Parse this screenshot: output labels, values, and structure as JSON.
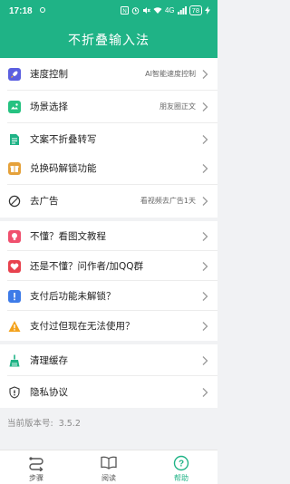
{
  "status_bar": {
    "time": "17:18",
    "network": "4G",
    "battery": "78"
  },
  "header": {
    "title": "不折叠输入法"
  },
  "colors": {
    "accent": "#1fb386",
    "background": "#f1f2f4"
  },
  "groups": [
    {
      "items": [
        {
          "label": "速度控制",
          "value": "AI智能速度控制",
          "icon": "rocket-icon"
        },
        {
          "label": "场景选择",
          "value": "朋友圈正文",
          "icon": "scene-icon"
        },
        {
          "label": "文案不折叠转写",
          "value": "",
          "icon": "document-icon"
        }
      ]
    },
    {
      "items": [
        {
          "label": "兑换码解锁功能",
          "value": "",
          "icon": "gift-icon"
        },
        {
          "label": "去广告",
          "value": "看视频去广告1天",
          "icon": "no-ads-icon"
        }
      ]
    },
    {
      "items": [
        {
          "label": "不懂？看图文教程",
          "value": "",
          "icon": "bulb-icon"
        },
        {
          "label": "还是不懂？问作者/加QQ群",
          "value": "",
          "icon": "heart-icon"
        },
        {
          "label": "支付后功能未解锁？",
          "value": "",
          "icon": "info-icon"
        },
        {
          "label": "支付过但现在无法使用？",
          "value": "",
          "icon": "warning-icon"
        }
      ]
    },
    {
      "items": [
        {
          "label": "清理缓存",
          "value": "",
          "icon": "broom-icon"
        },
        {
          "label": "隐私协议",
          "value": "",
          "icon": "shield-icon"
        }
      ]
    }
  ],
  "version": {
    "label": "当前版本号:",
    "number": "3.5.2"
  },
  "tabs": [
    {
      "label": "步骤",
      "icon": "steps-icon",
      "active": false
    },
    {
      "label": "阅读",
      "icon": "book-icon",
      "active": false
    },
    {
      "label": "帮助",
      "icon": "help-icon",
      "active": true
    }
  ]
}
